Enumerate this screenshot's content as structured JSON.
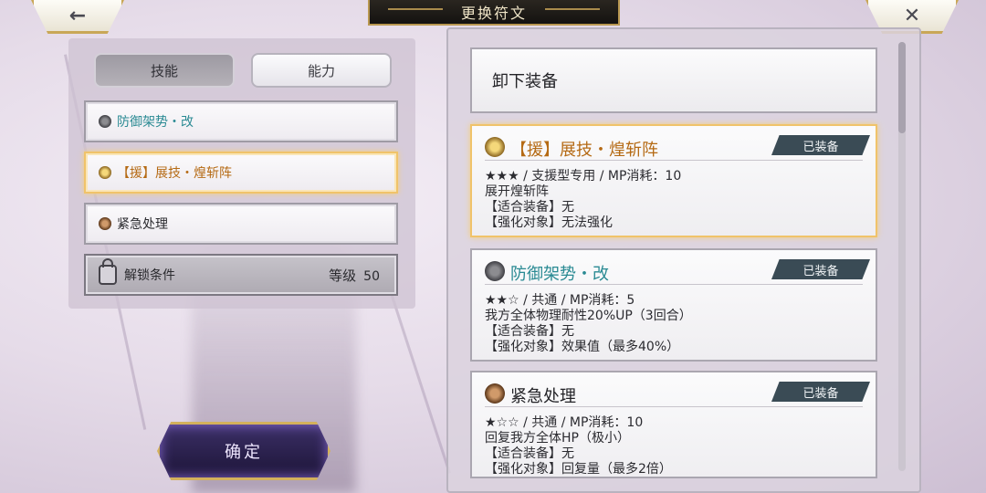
{
  "header": {
    "title": "更换符文",
    "back_icon": "←",
    "close_icon": "✕"
  },
  "tabs": {
    "skill": "技能",
    "ability": "能力"
  },
  "slots": [
    {
      "label": "防御架势・改",
      "color": "#2a8a93"
    },
    {
      "label": "【援】展技・煌斩阵",
      "color": "#b56a14"
    },
    {
      "label": "紧急处理",
      "color": "#2a2a2e"
    }
  ],
  "locked_slot": {
    "label": "解锁条件",
    "level_label": "等级",
    "level_value": "50"
  },
  "confirm_label": "确定",
  "unequip_label": "卸下装备",
  "runes": [
    {
      "name": "【援】展技・煌斩阵",
      "badge": "已装备",
      "line1": "★★★ / 支援型专用 / MP消耗：10",
      "line2": "展开煌斩阵",
      "line3": "【适合装备】无",
      "line4": "【强化对象】无法强化"
    },
    {
      "name": "防御架势・改",
      "badge": "已装备",
      "line1": "★★☆ / 共通 / MP消耗：5",
      "line2": "我方全体物理耐性20%UP（3回合）",
      "line3": "【适合装备】无",
      "line4": "【强化对象】效果值（最多40%）"
    },
    {
      "name": "紧急处理",
      "badge": "已装备",
      "line1": "★☆☆ / 共通 / MP消耗：10",
      "line2": "回复我方全体HP（极小）",
      "line3": "【适合装备】无",
      "line4": "【强化对象】回复量（最多2倍）"
    }
  ],
  "colors": {
    "accent_gold": "#b56a14",
    "accent_teal": "#2a8a93",
    "badge_bg": "#3a4b55",
    "frame_gold": "#c9a757"
  }
}
